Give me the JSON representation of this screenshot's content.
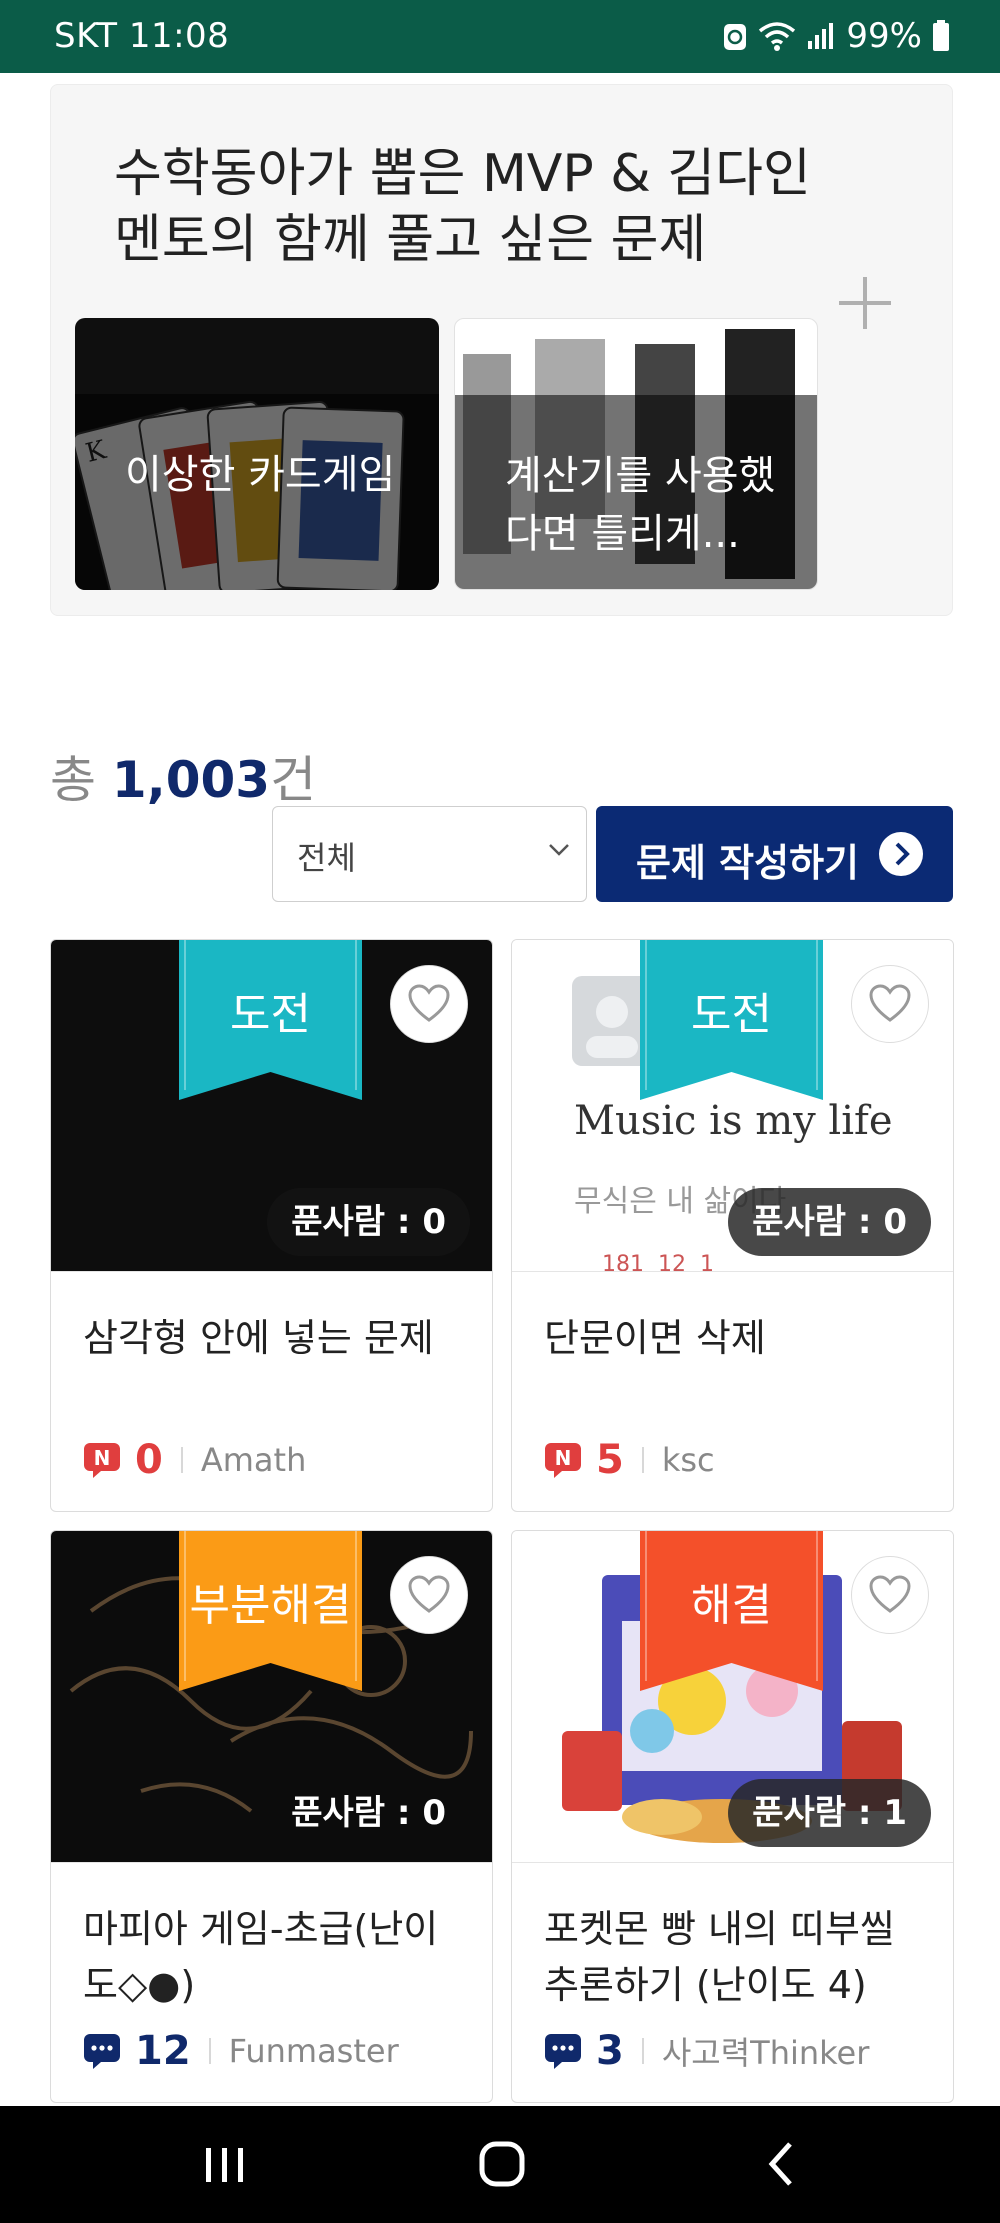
{
  "status_bar": {
    "carrier_time": "SKT 11:08",
    "battery": "99%",
    "icons": [
      "sync-icon",
      "wifi-icon",
      "signal-icon",
      "battery-icon"
    ]
  },
  "featured": {
    "title": "수학동아가 뽑은 MVP & 김다인 멘토의 함께 풀고 싶은 문제",
    "more_icon": "plus-icon",
    "cards": [
      {
        "caption": "이상한 카드게임"
      },
      {
        "caption": "계산기를 사용했다면 틀리게..."
      }
    ]
  },
  "summary": {
    "prefix": "총 ",
    "count": "1,003",
    "suffix": "건"
  },
  "filter": {
    "selected": "전체"
  },
  "write_button": {
    "label": "문제 작성하기"
  },
  "problems": [
    {
      "status": "도전",
      "status_color": "#1ab7c4",
      "solvers": "푼사람 : 0",
      "title": "삼각형 안에 넣는 문제",
      "comment_icon": "new-comment-icon",
      "comments": "0",
      "author": "Amath"
    },
    {
      "status": "도전",
      "status_color": "#1ab7c4",
      "solvers": "푼사람 : 0",
      "title": "단문이면 삭제",
      "comment_icon": "new-comment-icon",
      "comments": "5",
      "author": "ksc"
    },
    {
      "status": "부분해결",
      "status_color": "#fb9b16",
      "solvers": "푼사람 : 0",
      "title": "마피아 게임-초급(난이도◇●)",
      "comment_icon": "comment-icon",
      "comments": "12",
      "author": "Funmaster"
    },
    {
      "status": "해결",
      "status_color": "#f4502a",
      "solvers": "푼사람 : 1",
      "title": "포켓몬 빵 내의 띠부씰 추론하기 (난이도 4)",
      "comment_icon": "comment-icon",
      "comments": "3",
      "author": "사고력Thinker"
    }
  ],
  "thumbnail_texts": {
    "music_line1": "Music is my life",
    "music_line2": "무식은 내 삶이다",
    "music_stats": "181  12  1"
  },
  "colors": {
    "status_bar": "#0b5c48",
    "accent_navy": "#0b2a74",
    "count_red": "#e03e3e"
  }
}
